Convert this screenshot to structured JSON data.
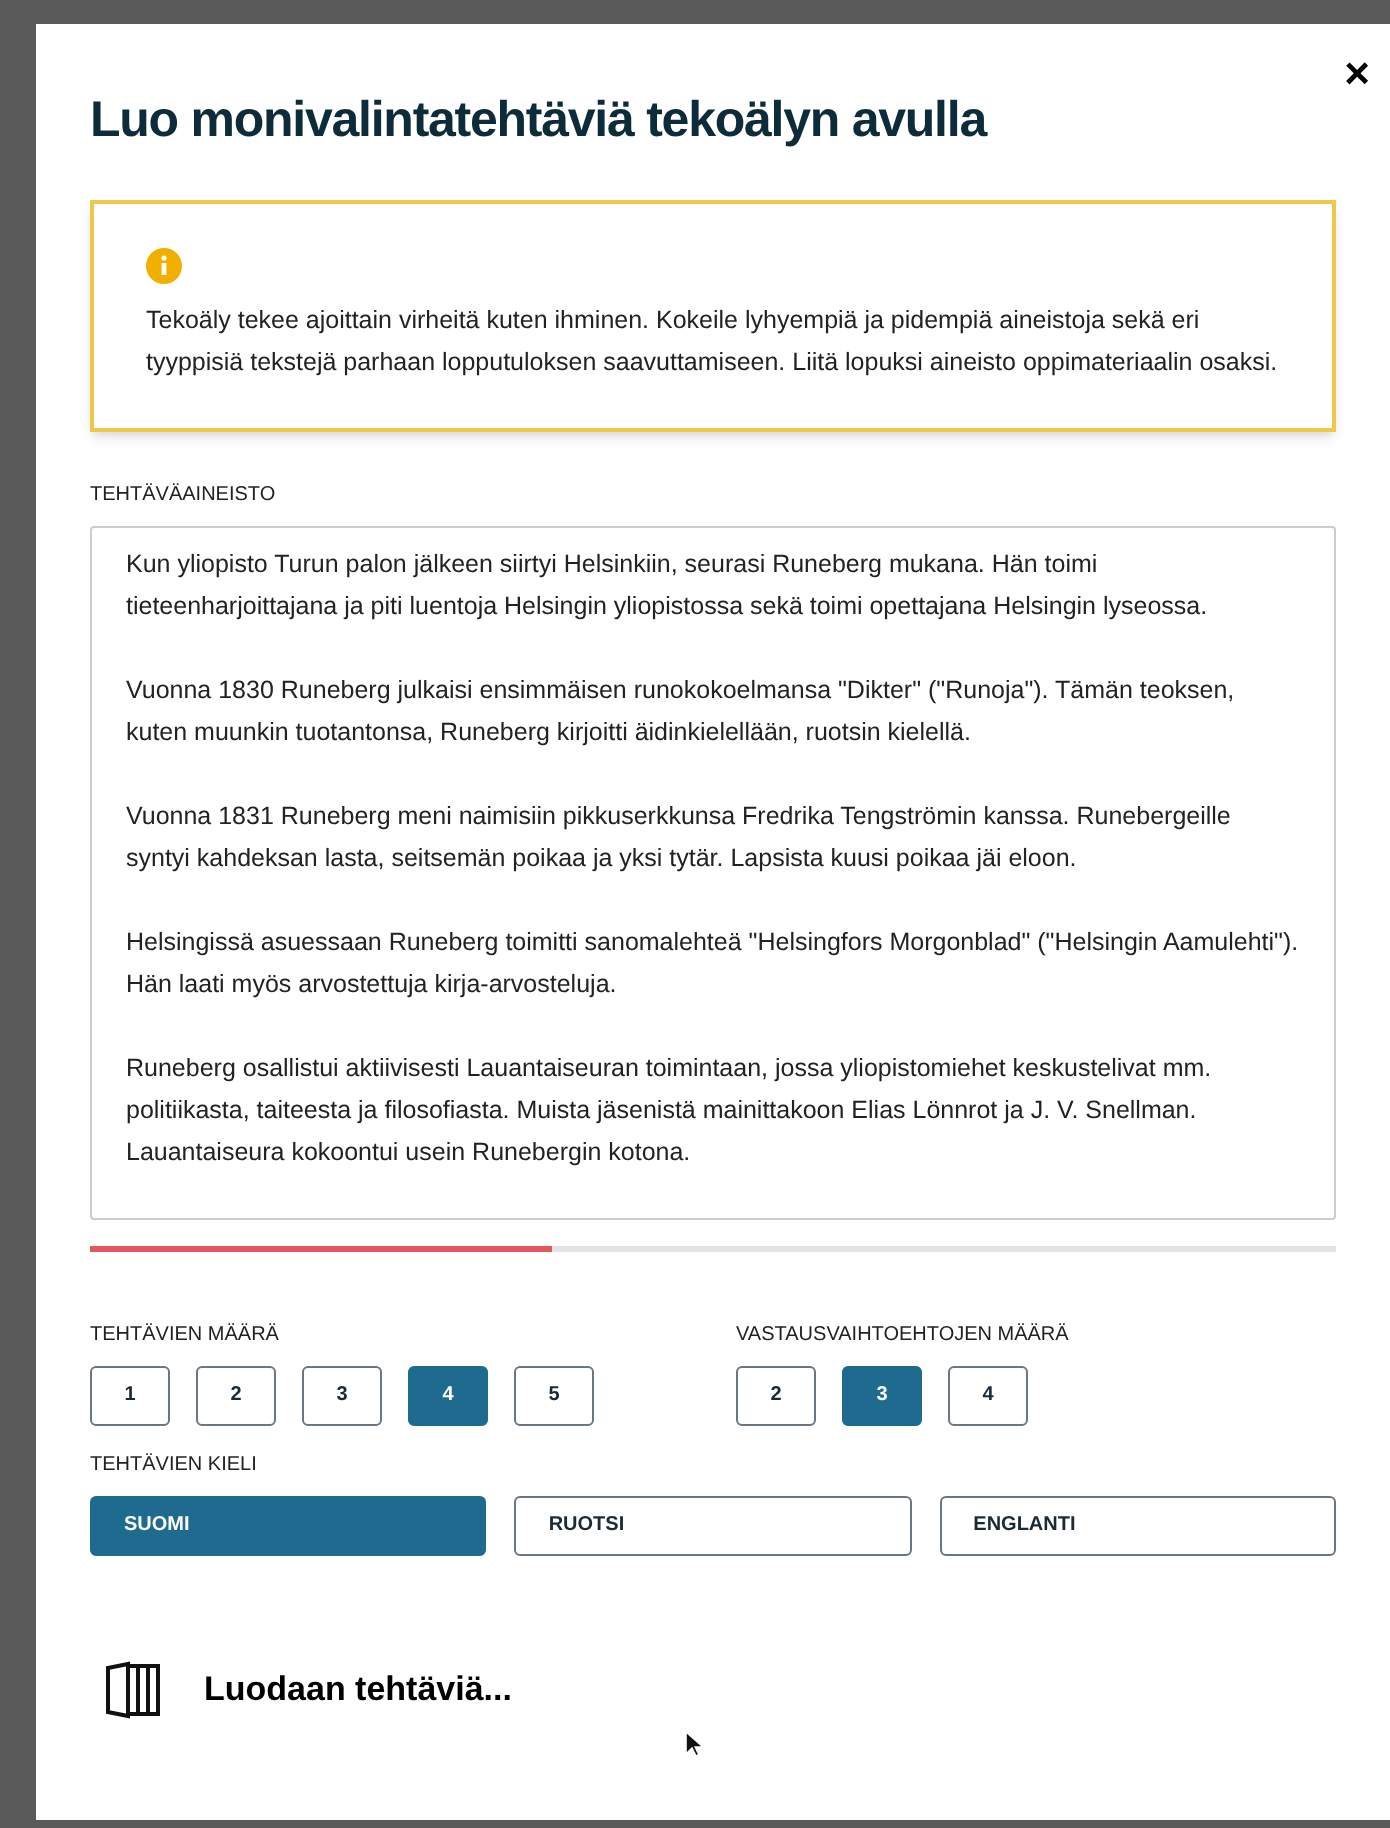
{
  "dialog": {
    "title": "Luo monivalintatehtäviä tekoälyn avulla",
    "close": "×"
  },
  "notice": {
    "text": "Tekoäly tekee ajoittain virheitä kuten ihminen. Kokeile lyhyempiä ja pidempiä aineistoja sekä eri tyyppisiä tekstejä parhaan lopputuloksen saavuttamiseen. Liitä lopuksi aineisto oppimateriaalin osaksi."
  },
  "material": {
    "label": "TEHTÄVÄAINEISTO",
    "paragraphs": [
      "Kun yliopisto Turun palon jälkeen siirtyi Helsinkiin, seurasi Runeberg mukana. Hän toimi tieteenharjoittajana ja piti luentoja Helsingin yliopistossa sekä toimi opettajana Helsingin lyseossa.",
      "Vuonna 1830 Runeberg julkaisi ensimmäisen runokokoelmansa \"Dikter\" (\"Runoja\"). Tämän teoksen, kuten muunkin tuotantonsa, Runeberg kirjoitti äidinkielellään, ruotsin kielellä.",
      "Vuonna 1831 Runeberg meni naimisiin pikkuserkkunsa Fredrika Tengströmin kanssa. Runebergeille syntyi kahdeksan lasta, seitsemän poikaa ja yksi tytär. Lapsista kuusi poikaa jäi eloon.",
      "Helsingissä asuessaan Runeberg toimitti sanomalehteä \"Helsingfors Morgonblad\" (\"Helsingin Aamulehti\"). Hän laati myös arvostettuja kirja-arvosteluja.",
      "Runeberg osallistui aktiivisesti Lauantaiseuran toimintaan, jossa yliopistomiehet keskustelivat mm. politiikasta, taiteesta ja filosofiasta. Muista jäsenistä mainittakoon Elias Lönnrot ja J. V. Snellman. Lauantaiseura kokoontui usein Runebergin kotona."
    ],
    "level": 0.37
  },
  "task_count": {
    "label": "TEHTÄVIEN MÄÄRÄ",
    "options": [
      {
        "label": "1",
        "selected": false
      },
      {
        "label": "2",
        "selected": false
      },
      {
        "label": "3",
        "selected": false
      },
      {
        "label": "4",
        "selected": true
      },
      {
        "label": "5",
        "selected": false
      }
    ]
  },
  "option_count": {
    "label": "VASTAUSVAIHTOEHTOJEN MÄÄRÄ",
    "options": [
      {
        "label": "2",
        "selected": false
      },
      {
        "label": "3",
        "selected": true
      },
      {
        "label": "4",
        "selected": false
      }
    ]
  },
  "language": {
    "label": "TEHTÄVIEN KIELI",
    "options": [
      {
        "label": "SUOMI",
        "selected": true
      },
      {
        "label": "RUOTSI",
        "selected": false
      },
      {
        "label": "ENGLANTI",
        "selected": false
      }
    ]
  },
  "status": {
    "text": "Luodaan tehtäviä..."
  }
}
